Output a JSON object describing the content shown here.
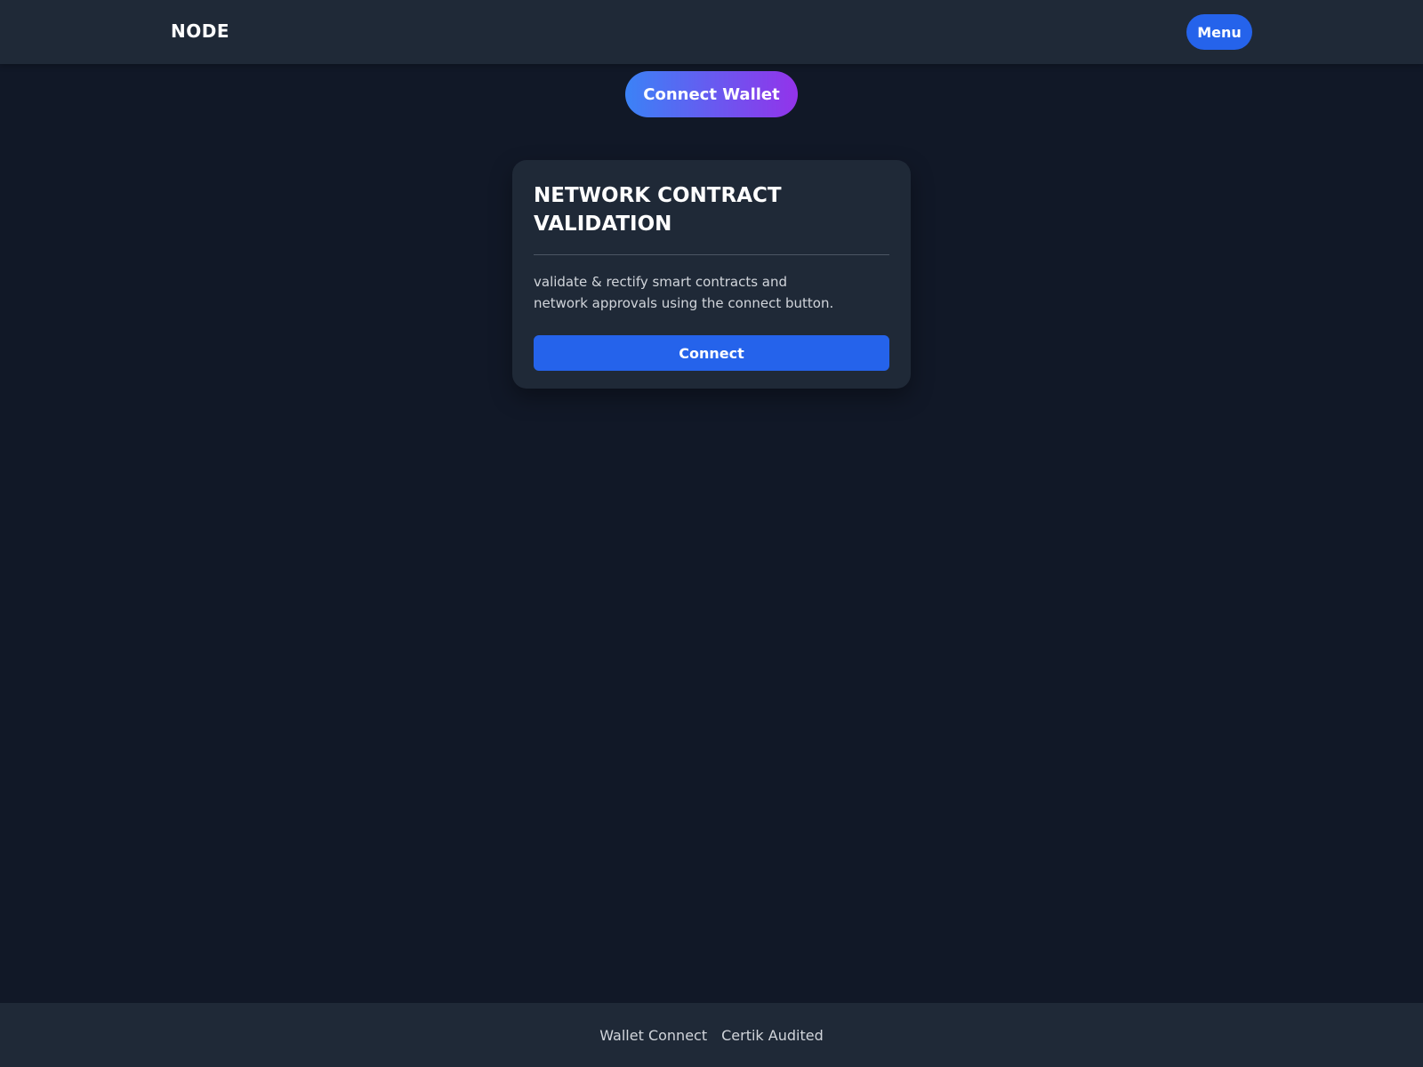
{
  "header": {
    "brand": "NODE",
    "menu_label": "Menu"
  },
  "hero": {
    "connect_wallet_label": "Connect Wallet"
  },
  "card": {
    "title": "NETWORK CONTRACT VALIDATION",
    "description": "validate & rectify smart contracts and network approvals using the connect button.",
    "button_label": "Connect"
  },
  "footer": {
    "links": [
      "Wallet Connect",
      "Certik Audited"
    ]
  },
  "colors": {
    "background": "#111827",
    "surface": "#1f2937",
    "primary": "#2563eb",
    "gradient_start": "#3b82f6",
    "gradient_end": "#9333ea"
  }
}
